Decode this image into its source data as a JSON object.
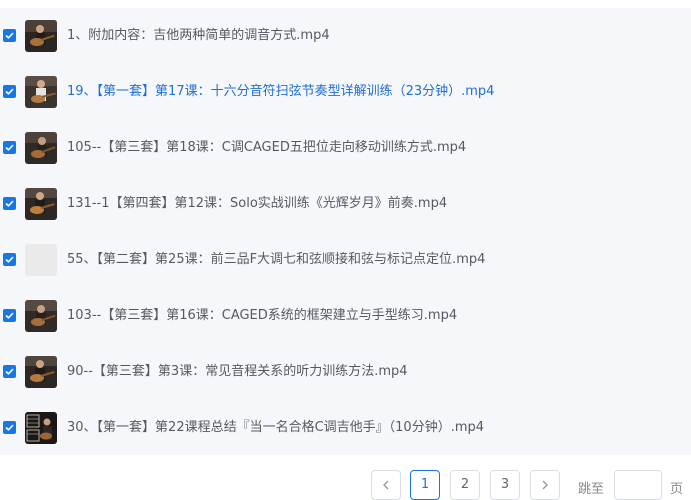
{
  "files": [
    {
      "name": "1、附加内容：吉他两种简单的调音方式.mp4",
      "checked": true,
      "thumb": "guitar-thumbnail",
      "active": false
    },
    {
      "name": "19、【第一套】第17课：十六分音符扫弦节奏型详解训练（23分钟）.mp4",
      "checked": true,
      "thumb": "guitar-thumbnail",
      "active": true
    },
    {
      "name": "105--【第三套】第18课：C调CAGED五把位走向移动训练方式.mp4",
      "checked": true,
      "thumb": "guitar-thumbnail",
      "active": false
    },
    {
      "name": "131--1【第四套】第12课：Solo实战训练《光辉岁月》前奏.mp4",
      "checked": true,
      "thumb": "guitar-thumbnail",
      "active": false
    },
    {
      "name": "55、【第二套】第25课：前三品F大调七和弦顺接和弦与标记点定位.mp4",
      "checked": true,
      "thumb": "blank-thumbnail",
      "active": false
    },
    {
      "name": "103--【第三套】第16课：CAGED系统的框架建立与手型练习.mp4",
      "checked": true,
      "thumb": "guitar-thumbnail",
      "active": false
    },
    {
      "name": "90--【第三套】第3课：常见音程关系的听力训练方法.mp4",
      "checked": true,
      "thumb": "guitar-thumbnail",
      "active": false
    },
    {
      "name": "30、【第一套】第22课程总结『当一名合格C调吉他手』（10分钟）.mp4",
      "checked": true,
      "thumb": "chord-chart-thumbnail",
      "active": false
    }
  ],
  "pagination": {
    "prev_icon": "chevron-left-icon",
    "pages": [
      "1",
      "2",
      "3"
    ],
    "current_page": "1",
    "next_icon": "chevron-right-icon",
    "jump_label": "跳至",
    "page_suffix": "页"
  },
  "colors": {
    "checkbox": "#1677e8",
    "active_link": "#1f6fd6",
    "text": "#555a62",
    "panel_bg": "#f6f7fa"
  }
}
